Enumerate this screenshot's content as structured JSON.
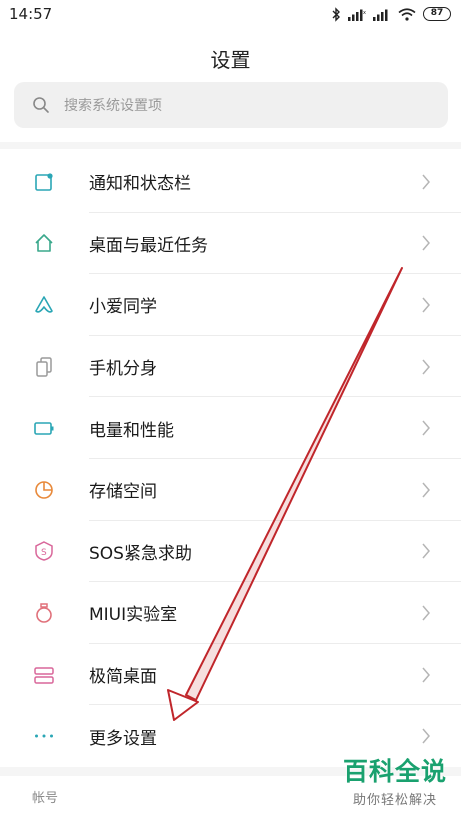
{
  "status_bar": {
    "time": "14:57",
    "battery": "87",
    "icons": [
      "bluetooth-icon",
      "signal-icon",
      "signal-icon",
      "wifi-icon",
      "battery-icon"
    ]
  },
  "header": {
    "title": "设置"
  },
  "search": {
    "placeholder": "搜索系统设置项",
    "icon": "search-icon"
  },
  "settings": {
    "items": [
      {
        "label": "通知和状态栏",
        "icon": "notification-icon",
        "color": "#2aa6b5"
      },
      {
        "label": "桌面与最近任务",
        "icon": "home-icon",
        "color": "#3aa88c"
      },
      {
        "label": "小爱同学",
        "icon": "xiaoai-icon",
        "color": "#2aa6b5"
      },
      {
        "label": "手机分身",
        "icon": "dual-phone-icon",
        "color": "#9a9a9a"
      },
      {
        "label": "电量和性能",
        "icon": "battery-icon",
        "color": "#2aa6b5"
      },
      {
        "label": "存储空间",
        "icon": "storage-pie-icon",
        "color": "#e8893a"
      },
      {
        "label": "SOS紧急求助",
        "icon": "sos-icon",
        "color": "#d9679a"
      },
      {
        "label": "MIUI实验室",
        "icon": "lab-flask-icon",
        "color": "#e0707a"
      },
      {
        "label": "极简桌面",
        "icon": "simple-desktop-icon",
        "color": "#d9679a"
      },
      {
        "label": "更多设置",
        "icon": "more-dots-icon",
        "color": "#2aa6b5"
      }
    ]
  },
  "section": {
    "account_header": "帐号"
  },
  "annotation": {
    "arrow_color": "#c0262b"
  },
  "watermark": {
    "logo": "百科全说",
    "tagline": "助你轻松解决"
  }
}
